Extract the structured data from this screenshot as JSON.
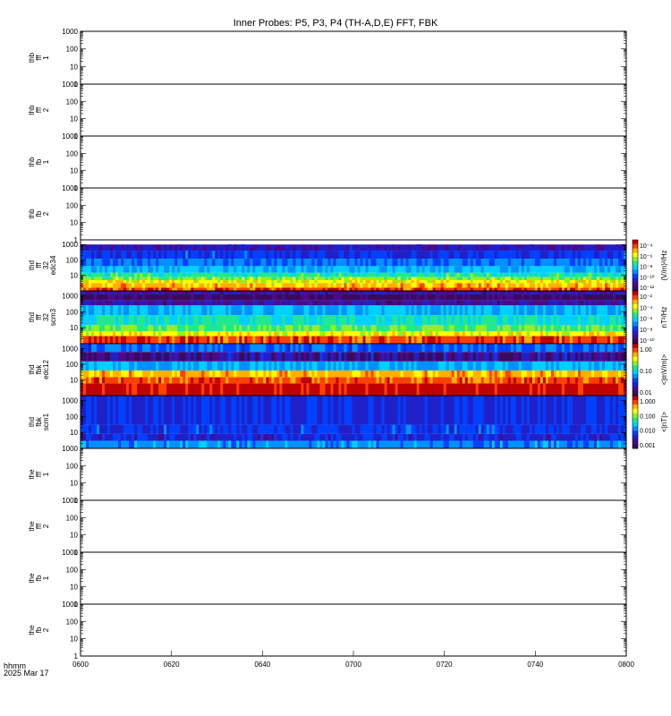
{
  "title": "Inner Probes: P5, P3, P4 (TH-A,D,E) FFT, FBK",
  "footer": {
    "time_label": "hhmm",
    "date_label": "2025 Mar 17"
  },
  "time_axis": {
    "ticks": [
      "0600",
      "0620",
      "0640",
      "0700",
      "0720",
      "0740",
      "0800"
    ]
  },
  "colors": {
    "axis": "#000000",
    "colormap": [
      "#3a0a5e",
      "#4b0a8c",
      "#2020c8",
      "#0040ff",
      "#0090ff",
      "#00d0ff",
      "#20e890",
      "#90f020",
      "#ffff00",
      "#ffb000",
      "#ff4000",
      "#c00000"
    ]
  },
  "chart_data": [
    {
      "type": "heatmap",
      "panel_label": [
        "thb",
        "fff",
        "1"
      ],
      "yticks": [
        "1000",
        "100",
        "10",
        "1"
      ],
      "ylim": [
        1,
        1000
      ],
      "yscale": "log",
      "data": "none"
    },
    {
      "type": "heatmap",
      "panel_label": [
        "thb",
        "fff",
        "2"
      ],
      "yticks": [
        "1000",
        "100",
        "10",
        "1"
      ],
      "ylim": [
        1,
        1000
      ],
      "yscale": "log",
      "data": "none"
    },
    {
      "type": "heatmap",
      "panel_label": [
        "thb",
        "fb",
        "1"
      ],
      "yticks": [
        "1000",
        "100",
        "10",
        "1"
      ],
      "ylim": [
        1,
        1000
      ],
      "yscale": "log",
      "data": "none"
    },
    {
      "type": "heatmap",
      "panel_label": [
        "thb",
        "fb",
        "2"
      ],
      "yticks": [
        "1000",
        "100",
        "10",
        "1"
      ],
      "ylim": [
        1,
        1000
      ],
      "yscale": "log",
      "data": "none"
    },
    {
      "type": "heatmap",
      "panel_label": [
        "thd",
        "fff",
        "32",
        "edc34"
      ],
      "yticks": [
        "1000",
        "100",
        "10"
      ],
      "ylim": [
        1,
        2000
      ],
      "yscale": "log",
      "bands": [
        {
          "from": 1,
          "to": 1.6,
          "level": 0.92
        },
        {
          "from": 1.6,
          "to": 3.2,
          "level": 0.8
        },
        {
          "from": 3.2,
          "to": 5,
          "level": 0.72
        },
        {
          "from": 5,
          "to": 8,
          "level": 0.62
        },
        {
          "from": 8,
          "to": 15,
          "level": 0.52
        },
        {
          "from": 15,
          "to": 40,
          "level": 0.42
        },
        {
          "from": 40,
          "to": 120,
          "level": 0.33
        },
        {
          "from": 120,
          "to": 400,
          "level": 0.24
        },
        {
          "from": 400,
          "to": 1000,
          "level": 0.15
        }
      ],
      "colorbar": {
        "ticks": [
          "10⁻⁴",
          "10⁻⁶",
          "10⁻⁸",
          "10⁻¹⁰",
          "10⁻¹²"
        ],
        "label": "(V/m)²/Hz"
      }
    },
    {
      "type": "heatmap",
      "panel_label": [
        "thd",
        "fff",
        "32",
        "scm3"
      ],
      "yticks": [
        "1000",
        "100",
        "10"
      ],
      "ylim": [
        1,
        2000
      ],
      "yscale": "log",
      "bands": [
        {
          "from": 1,
          "to": 3,
          "level": 0.92
        },
        {
          "from": 3,
          "to": 6,
          "level": 0.72
        },
        {
          "from": 6,
          "to": 15,
          "level": 0.58
        },
        {
          "from": 15,
          "to": 60,
          "level": 0.5
        },
        {
          "from": 60,
          "to": 250,
          "level": 0.42
        },
        {
          "from": 250,
          "to": 500,
          "level": 0.12
        },
        {
          "from": 500,
          "to": 1200,
          "level": 0.02
        },
        {
          "from": 1200,
          "to": 2000,
          "level": 0.12
        }
      ],
      "colorbar": {
        "ticks": [
          "10⁻²",
          "10⁻⁴",
          "10⁻⁶",
          "10⁻⁸",
          "10⁻¹⁰"
        ],
        "label": "nT²/Hz"
      }
    },
    {
      "type": "heatmap",
      "panel_label": [
        "thd",
        "fbk",
        "edc12"
      ],
      "yticks": [
        "1000",
        "100",
        "10"
      ],
      "ylim": [
        1,
        2000
      ],
      "yscale": "log",
      "bands": [
        {
          "from": 1,
          "to": 6,
          "level": 1.0
        },
        {
          "from": 6,
          "to": 15,
          "level": 0.9
        },
        {
          "from": 15,
          "to": 40,
          "level": 0.8
        },
        {
          "from": 40,
          "to": 150,
          "level": 0.4
        },
        {
          "from": 150,
          "to": 600,
          "level": 0.06
        },
        {
          "from": 600,
          "to": 2000,
          "level": 0.3
        }
      ],
      "colorbar": {
        "ticks": [
          "1.00",
          "0.10",
          "0.01"
        ],
        "label": "<|mV/m|>"
      }
    },
    {
      "type": "heatmap",
      "panel_label": [
        "thd",
        "fbk",
        "scm1"
      ],
      "yticks": [
        "1000",
        "100",
        "10"
      ],
      "ylim": [
        1,
        2000
      ],
      "yscale": "log",
      "bands": [
        {
          "from": 1,
          "to": 3,
          "level": 0.36
        },
        {
          "from": 3,
          "to": 8,
          "level": 0.2
        },
        {
          "from": 8,
          "to": 30,
          "level": 0.25
        },
        {
          "from": 30,
          "to": 2000,
          "level": 0.22
        }
      ],
      "colorbar": {
        "ticks": [
          "1.000",
          "0.100",
          "0.010",
          "0.001"
        ],
        "label": "<|nT|>"
      }
    },
    {
      "type": "heatmap",
      "panel_label": [
        "the",
        "fff",
        "1"
      ],
      "yticks": [
        "1000",
        "100",
        "10",
        "1"
      ],
      "ylim": [
        1,
        1000
      ],
      "yscale": "log",
      "data": "none"
    },
    {
      "type": "heatmap",
      "panel_label": [
        "the",
        "fff",
        "2"
      ],
      "yticks": [
        "1000",
        "100",
        "10",
        "1"
      ],
      "ylim": [
        1,
        1000
      ],
      "yscale": "log",
      "data": "none"
    },
    {
      "type": "heatmap",
      "panel_label": [
        "the",
        "fb",
        "1"
      ],
      "yticks": [
        "1000",
        "100",
        "10",
        "1"
      ],
      "ylim": [
        1,
        1000
      ],
      "yscale": "log",
      "data": "none"
    },
    {
      "type": "heatmap",
      "panel_label": [
        "the",
        "fb",
        "2"
      ],
      "yticks": [
        "1000",
        "100",
        "10",
        "1"
      ],
      "ylim": [
        1,
        1000
      ],
      "yscale": "log",
      "data": "none"
    }
  ]
}
